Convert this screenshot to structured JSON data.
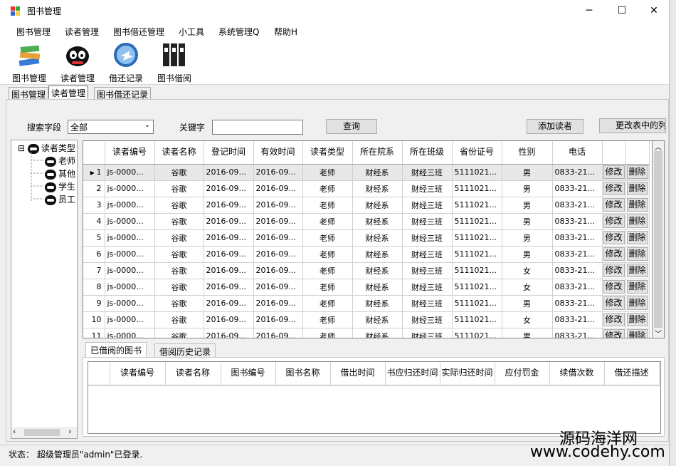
{
  "window": {
    "title": "图书管理",
    "minimize": "─",
    "maximize": "☐",
    "close": "✕"
  },
  "menu": [
    "图书管理",
    "读者管理",
    "图书借还管理",
    "小工具",
    "系统管理Q",
    "帮助H"
  ],
  "toolbar": [
    {
      "label": "图书管理",
      "icon": "books-icon",
      "color": "#4a8fd6"
    },
    {
      "label": "读者管理",
      "icon": "reader-panda-icon",
      "color": "#111111"
    },
    {
      "label": "借还记录",
      "icon": "return-arrow-icon",
      "color": "#2a6db5"
    },
    {
      "label": "图书借阅",
      "icon": "binders-icon",
      "color": "#222222"
    }
  ],
  "tabs": [
    "图书管理",
    "读者管理",
    "图书借还记录"
  ],
  "search": {
    "field_label": "搜索字段",
    "field_value": "全部",
    "keyword_label": "关键字",
    "keyword_value": "",
    "query_button": "查询",
    "add_button": "添加读者",
    "change_button": "更改表中的列"
  },
  "tree": {
    "root": "读者类型",
    "collapse": "⊟",
    "children": [
      "老师",
      "其他",
      "学生",
      "员工"
    ]
  },
  "grid": {
    "columns": [
      "读者编号",
      "读者名称",
      "登记时间",
      "有效时间",
      "读者类型",
      "所在院系",
      "所在班级",
      "省份证号",
      "性别",
      "电话",
      "",
      ""
    ],
    "rows": [
      [
        "1",
        "js-0000...",
        "谷歌",
        "2016-09...",
        "2016-09...",
        "老师",
        "财经系",
        "财经三班",
        "5111021...",
        "男",
        "0833-21...",
        "修改",
        "删除"
      ],
      [
        "2",
        "js-0000...",
        "谷歌",
        "2016-09...",
        "2016-09...",
        "老师",
        "财经系",
        "财经三班",
        "5111021...",
        "男",
        "0833-21...",
        "修改",
        "删除"
      ],
      [
        "3",
        "js-0000...",
        "谷歌",
        "2016-09...",
        "2016-09...",
        "老师",
        "财经系",
        "财经三班",
        "5111021...",
        "男",
        "0833-21...",
        "修改",
        "删除"
      ],
      [
        "4",
        "js-0000...",
        "谷歌",
        "2016-09...",
        "2016-09...",
        "老师",
        "财经系",
        "财经三班",
        "5111021...",
        "男",
        "0833-21...",
        "修改",
        "删除"
      ],
      [
        "5",
        "js-0000...",
        "谷歌",
        "2016-09...",
        "2016-09...",
        "老师",
        "财经系",
        "财经三班",
        "5111021...",
        "男",
        "0833-21...",
        "修改",
        "删除"
      ],
      [
        "6",
        "js-0000...",
        "谷歌",
        "2016-09...",
        "2016-09...",
        "老师",
        "财经系",
        "财经三班",
        "5111021...",
        "男",
        "0833-21...",
        "修改",
        "删除"
      ],
      [
        "7",
        "js-0000...",
        "谷歌",
        "2016-09...",
        "2016-09...",
        "老师",
        "财经系",
        "财经三班",
        "5111021...",
        "女",
        "0833-21...",
        "修改",
        "删除"
      ],
      [
        "8",
        "js-0000...",
        "谷歌",
        "2016-09...",
        "2016-09...",
        "老师",
        "财经系",
        "财经三班",
        "5111021...",
        "女",
        "0833-21...",
        "修改",
        "删除"
      ],
      [
        "9",
        "js-0000...",
        "谷歌",
        "2016-09...",
        "2016-09...",
        "老师",
        "财经系",
        "财经三班",
        "5111021...",
        "男",
        "0833-21...",
        "修改",
        "删除"
      ],
      [
        "10",
        "js-0000...",
        "谷歌",
        "2016-09...",
        "2016-09...",
        "老师",
        "财经系",
        "财经三班",
        "5111021...",
        "女",
        "0833-21...",
        "修改",
        "删除"
      ],
      [
        "11",
        "js-0000...",
        "谷歌",
        "2016-09...",
        "2016-09...",
        "老师",
        "财经系",
        "财经三班",
        "5111021...",
        "男",
        "0833-21...",
        "修改",
        "删除"
      ]
    ]
  },
  "subtabs": [
    "已借阅的图书",
    "借阅历史记录"
  ],
  "subgrid": {
    "columns": [
      "读者编号",
      "读者名称",
      "图书编号",
      "图书名称",
      "借出时间",
      "书应归还时间",
      "实际归还时间",
      "应付罚金",
      "续借次数",
      "借还描述"
    ]
  },
  "status": "状态：  超级管理员\"admin\"已登录.",
  "watermark": {
    "line1": "源码海洋网",
    "line2": "www.codehy.com"
  }
}
